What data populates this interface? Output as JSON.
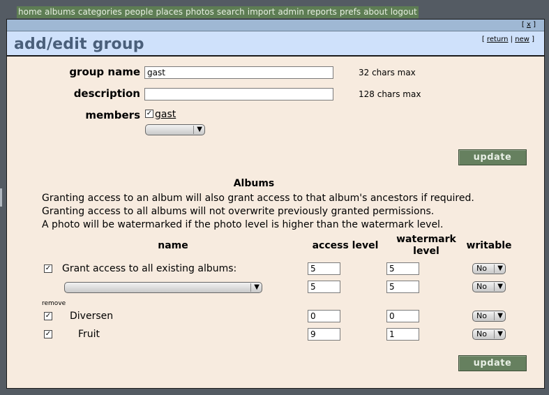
{
  "menu": {
    "items": [
      "home",
      "albums",
      "categories",
      "people",
      "places",
      "photos",
      "search",
      "import",
      "admin",
      "reports",
      "prefs",
      "about",
      "logout"
    ]
  },
  "window": {
    "close_label": "x",
    "title": "add/edit group",
    "return_label": "return",
    "new_label": "new"
  },
  "form": {
    "group_name_label": "group name",
    "group_name_value": "gast",
    "group_name_hint": "32 chars max",
    "description_label": "description",
    "description_value": "",
    "description_hint": "128 chars max",
    "members_label": "members",
    "member_name": "gast",
    "member_checked": true,
    "members_select_value": "",
    "update_label": "update"
  },
  "albums": {
    "heading": "Albums",
    "info_lines": [
      "Granting access to an album will also grant access to that album's ancestors if required.",
      "Granting access to all albums will not overwrite previously granted permissions.",
      "A photo will be watermarked if the photo level is higher than the watermark level."
    ],
    "columns": {
      "name": "name",
      "access_level": "access level",
      "watermark_level": "watermark level",
      "writable": "writable"
    },
    "grant_all": {
      "label": "Grant access to all existing albums:",
      "checked": true,
      "access": "5",
      "watermark": "5",
      "writable": "No"
    },
    "new_album": {
      "select_value": "",
      "access": "5",
      "watermark": "5",
      "writable": "No"
    },
    "remove_label": "remove",
    "rows": [
      {
        "name": "Diversen",
        "checked": true,
        "access": "0",
        "watermark": "0",
        "writable": "No"
      },
      {
        "name": "Fruit",
        "checked": true,
        "access": "9",
        "watermark": "1",
        "writable": "No"
      }
    ],
    "update_label": "update"
  }
}
